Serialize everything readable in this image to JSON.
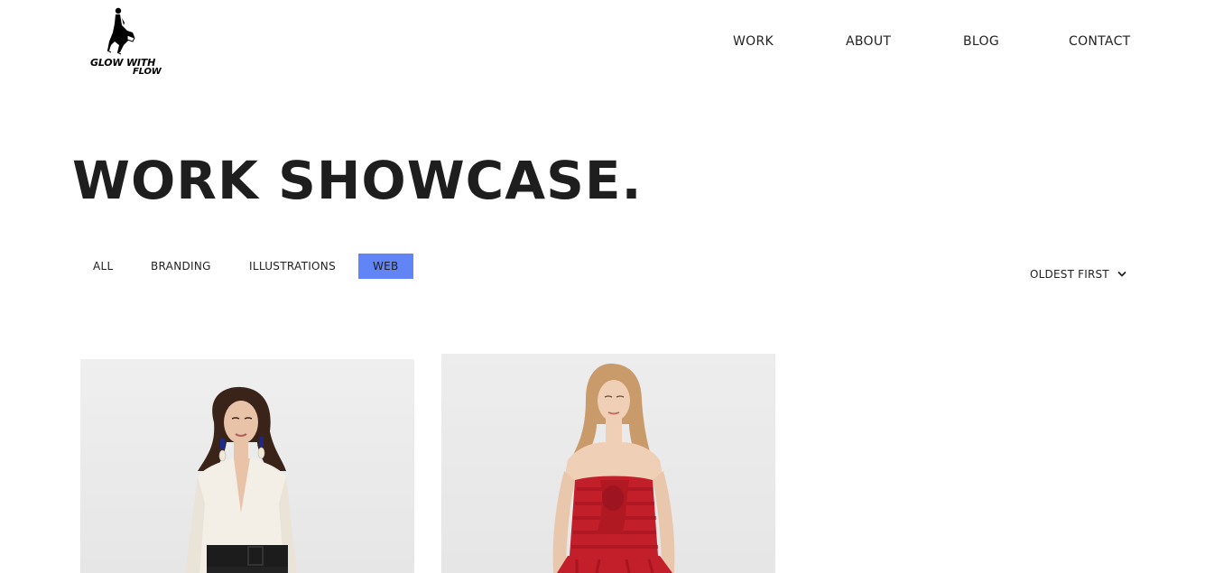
{
  "brand": {
    "logo_line1": "GLOW WITH",
    "logo_line2": "FLOW"
  },
  "nav": {
    "items": [
      {
        "label": "WORK"
      },
      {
        "label": "ABOUT"
      },
      {
        "label": "BLOG"
      },
      {
        "label": "CONTACT"
      }
    ]
  },
  "page": {
    "title": "WORK SHOWCASE."
  },
  "filters": {
    "items": [
      {
        "label": "ALL"
      },
      {
        "label": "BRANDING"
      },
      {
        "label": "ILLUSTRATIONS"
      },
      {
        "label": "WEB",
        "active": true
      }
    ],
    "active_color": "#6184f7"
  },
  "sort": {
    "label": "OLDEST FIRST",
    "icon": "chevron-down-icon"
  },
  "gallery": {
    "items": [
      {
        "icon": "model-photo-white-blouse"
      },
      {
        "icon": "model-photo-red-dress"
      }
    ],
    "background": "#ececec"
  }
}
